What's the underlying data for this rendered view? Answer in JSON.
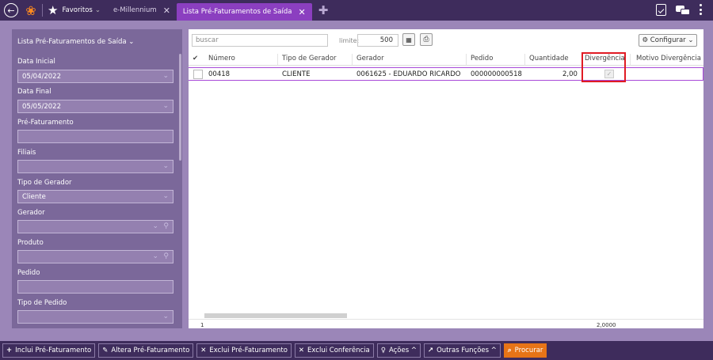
{
  "topbar": {
    "favoritos_label": "Favoritos",
    "favoritos_chevron": "⌄",
    "tab1_label": "e-Millennium",
    "tab2_label": "Lista Pré-Faturamentos de Saída",
    "close_glyph": "✕",
    "add_glyph": "✚"
  },
  "sidebar": {
    "title": "Lista Pré-Faturamentos de Saída ⌄",
    "fields": [
      {
        "label": "Data Inicial",
        "value": "05/04/2022"
      },
      {
        "label": "Data Final",
        "value": "05/05/2022"
      },
      {
        "label": "Pré-Faturamento",
        "value": ""
      },
      {
        "label": "Filiais",
        "value": ""
      },
      {
        "label": "Tipo de Gerador",
        "value": "Cliente"
      },
      {
        "label": "Gerador",
        "value": ""
      },
      {
        "label": "Produto",
        "value": ""
      },
      {
        "label": "Pedido",
        "value": ""
      },
      {
        "label": "Tipo de Pedido",
        "value": ""
      }
    ]
  },
  "toolbar": {
    "search_placeholder": "buscar",
    "limite_label": "limite:",
    "limite_value": "500",
    "configurar_label": "⚙ Configurar ⌄"
  },
  "table": {
    "check_header": "✔",
    "headers": [
      "Número",
      "Tipo de Gerador",
      "Gerador",
      "Pedido",
      "Quantidade",
      "Divergência",
      "Motivo Divergência"
    ],
    "rows": [
      {
        "numero": "00418",
        "tipo_gerador": "CLIENTE",
        "gerador": "0061625 - EDUARDO RICARDO",
        "pedido": "000000000518",
        "quantidade": "2,00",
        "divergencia": "✓",
        "motivo": ""
      }
    ],
    "footer_count": "1",
    "footer_total": "2,0000"
  },
  "bottombar": {
    "buttons": [
      {
        "icon": "+",
        "label": "Inclui Pré-Faturamento"
      },
      {
        "icon": "✎",
        "label": "Altera Pré-Faturamento"
      },
      {
        "icon": "✕",
        "label": "Exclui Pré-Faturamento"
      },
      {
        "icon": "✕",
        "label": "Exclui Conferência"
      },
      {
        "icon": "♀",
        "label": "Ações ^"
      },
      {
        "icon": "↗",
        "label": "Outras Funções ^"
      },
      {
        "icon": "⌕",
        "label": "Procurar"
      }
    ]
  },
  "colors": {
    "accent": "#8b3fc0",
    "highlight": "#e01b24",
    "search_button": "#e77417"
  }
}
